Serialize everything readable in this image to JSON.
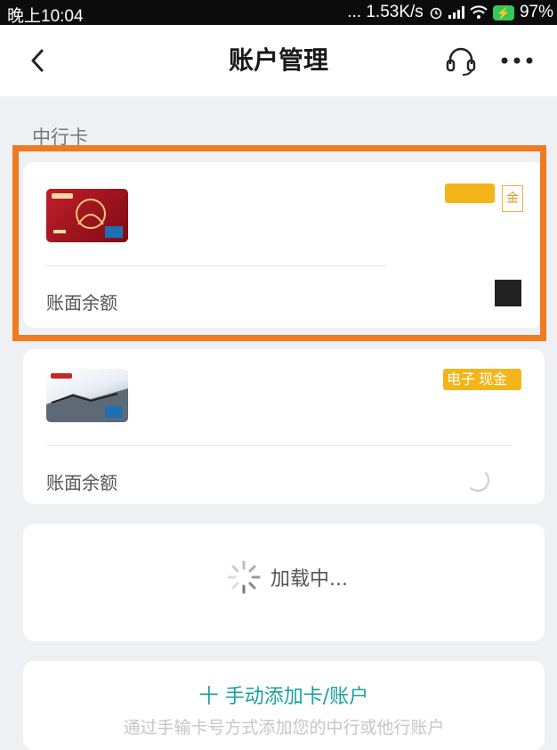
{
  "status_bar": {
    "time": "晚上10:04",
    "speed": "... 1.53K/s",
    "battery": "97%"
  },
  "header": {
    "title": "账户管理",
    "back_icon": "chevron-left-icon",
    "service_icon": "headset-icon",
    "more_icon": "more-horizontal-icon"
  },
  "section": {
    "label": "中行卡"
  },
  "cards": [
    {
      "balance_label": "账面余额",
      "tag_partial": "金",
      "brand_color": "#c21d2a"
    },
    {
      "balance_label": "账面余额",
      "tag_text": "电子",
      "tag_partial": "现金"
    }
  ],
  "loading": {
    "text": "加载中..."
  },
  "add": {
    "title": "十 手动添加卡/账户",
    "subtitle": "通过手输卡号方式添加您的中行或他行账户"
  },
  "colors": {
    "highlight": "#f07a1f",
    "accent": "#1aa0a0",
    "tag": "#f3b519"
  }
}
